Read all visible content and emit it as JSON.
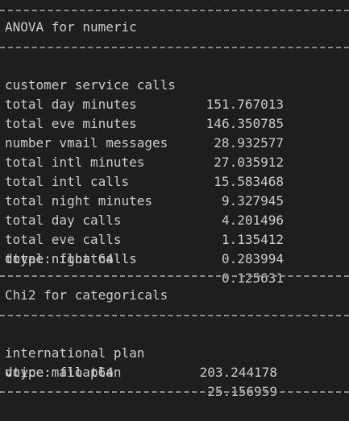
{
  "output": {
    "anova_title": "ANOVA for numeric",
    "anova_rows": [
      {
        "name": "customer service calls",
        "value": "151.767013"
      },
      {
        "name": "total day minutes",
        "value": "146.350785"
      },
      {
        "name": "total eve minutes",
        "value": "28.932577"
      },
      {
        "name": "number vmail messages",
        "value": "27.035912"
      },
      {
        "name": "total intl minutes",
        "value": "15.583468"
      },
      {
        "name": "total intl calls",
        "value": "9.327945"
      },
      {
        "name": "total night minutes",
        "value": "4.201496"
      },
      {
        "name": "total day calls",
        "value": "1.135412"
      },
      {
        "name": "total eve calls",
        "value": "0.283994"
      },
      {
        "name": "total night calls",
        "value": "0.125631"
      }
    ],
    "anova_dtype": "dtype: float64",
    "chi_title": "Chi2 for categoricals",
    "chi_rows": [
      {
        "name": "international plan",
        "value": "203.244178"
      },
      {
        "name": "voice mail plan",
        "value": "25.156959"
      }
    ],
    "chi_dtype": "dtype: float64"
  }
}
